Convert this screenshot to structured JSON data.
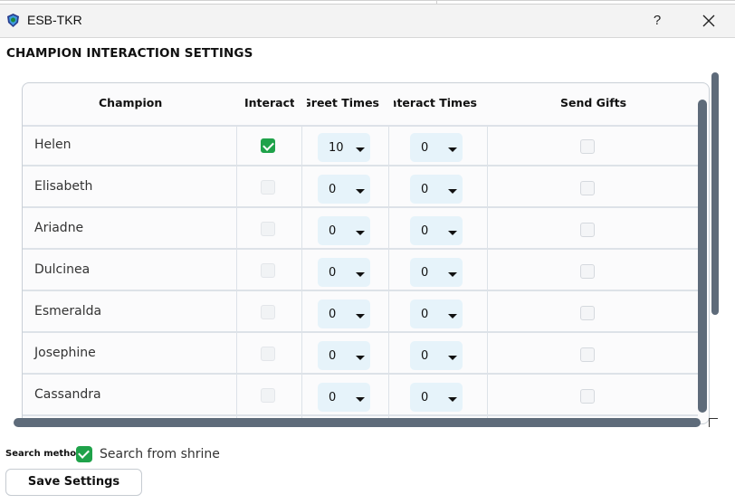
{
  "window": {
    "title": "ESB-TKR",
    "help_label": "?",
    "close_icon": "close-icon"
  },
  "heading": "CHAMPION INTERACTION SETTINGS",
  "table": {
    "columns": [
      "Champion",
      "Interact",
      "Greet Times",
      "Interact Times",
      "Send Gifts"
    ],
    "rows": [
      {
        "name": "Helen",
        "interact": true,
        "interact_enabled": true,
        "greet": "10",
        "interact_times": "0",
        "send_gifts": false
      },
      {
        "name": "Elisabeth",
        "interact": false,
        "interact_enabled": false,
        "greet": "0",
        "interact_times": "0",
        "send_gifts": false
      },
      {
        "name": "Ariadne",
        "interact": false,
        "interact_enabled": false,
        "greet": "0",
        "interact_times": "0",
        "send_gifts": false
      },
      {
        "name": "Dulcinea",
        "interact": false,
        "interact_enabled": false,
        "greet": "0",
        "interact_times": "0",
        "send_gifts": false
      },
      {
        "name": "Esmeralda",
        "interact": false,
        "interact_enabled": false,
        "greet": "0",
        "interact_times": "0",
        "send_gifts": false
      },
      {
        "name": "Josephine",
        "interact": false,
        "interact_enabled": false,
        "greet": "0",
        "interact_times": "0",
        "send_gifts": false
      },
      {
        "name": "Cassandra",
        "interact": false,
        "interact_enabled": false,
        "greet": "0",
        "interact_times": "0",
        "send_gifts": false
      }
    ]
  },
  "search": {
    "label": "Search method",
    "option_label": "Search from shrine",
    "checked": true
  },
  "save_button": "Save Settings",
  "colors": {
    "accent_green": "#1fa24a",
    "dropdown_bg": "#e6f3fa",
    "scrollbar": "#5e6b7a"
  }
}
